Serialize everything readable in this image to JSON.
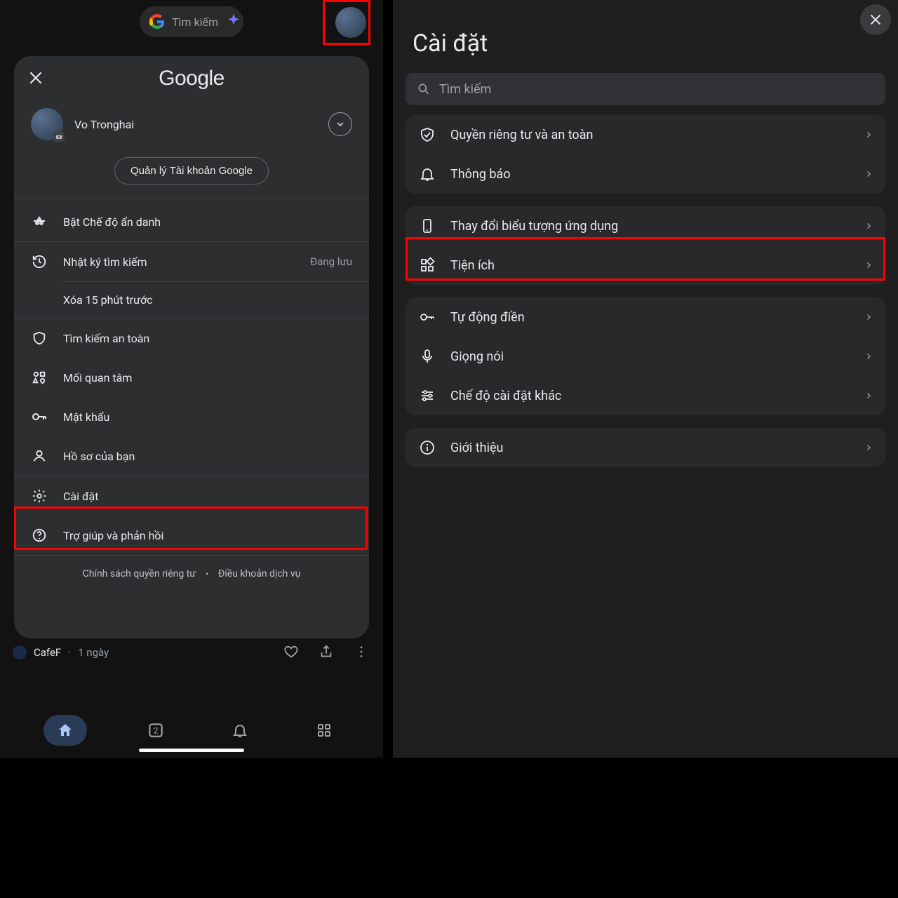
{
  "left": {
    "search_placeholder": "Tìm kiếm",
    "google_word": "Google",
    "account_name": "Vo Tronghai",
    "manage_account": "Quản lý Tài khoản Google",
    "menu": {
      "incognito": "Bật Chế độ ẩn danh",
      "history": "Nhật ký tìm kiếm",
      "history_trailing": "Đang lưu",
      "delete15": "Xóa 15 phút trước",
      "safesearch": "Tìm kiếm an toàn",
      "interests": "Mối quan tâm",
      "passwords": "Mật khẩu",
      "profile": "Hồ sơ của bạn",
      "settings": "Cài đặt",
      "help": "Trợ giúp và phản hồi"
    },
    "footer": {
      "privacy": "Chính sách quyền riêng tư",
      "terms": "Điều khoản dịch vụ"
    },
    "feed_source": "CafeF",
    "feed_time": "1 ngày",
    "tab_count": "2"
  },
  "right": {
    "title": "Cài đặt",
    "search_placeholder": "Tìm kiếm",
    "group1": {
      "privacy": "Quyền riêng tư và an toàn",
      "notifications": "Thông báo"
    },
    "group2": {
      "app_icon": "Thay đổi biểu tượng ứng dụng",
      "widgets": "Tiện ích"
    },
    "group3": {
      "autofill": "Tự động điền",
      "voice": "Giọng nói",
      "other": "Chế độ cài đặt khác"
    },
    "group4": {
      "about": "Giới thiệu"
    }
  },
  "icons": {
    "search": "search-icon",
    "sparkle": "sparkle-icon",
    "close": "close-icon",
    "chevron_down": "chevron-down-icon",
    "chevron_right": "chevron-right-icon",
    "incognito": "incognito-icon",
    "history": "history-icon",
    "shield": "shield-icon",
    "interests": "interests-icon",
    "key": "key-icon",
    "person": "person-icon",
    "gear": "gear-icon",
    "help": "help-icon",
    "home": "home-icon",
    "tabs": "tabs-icon",
    "bell": "bell-icon",
    "grid": "grid-icon",
    "heart": "heart-icon",
    "share": "share-icon",
    "more": "more-icon",
    "phone": "phone-icon",
    "widgets": "widgets-icon",
    "mic": "mic-icon",
    "sliders": "sliders-icon",
    "info": "info-icon",
    "shield_check": "shield-check-icon"
  }
}
